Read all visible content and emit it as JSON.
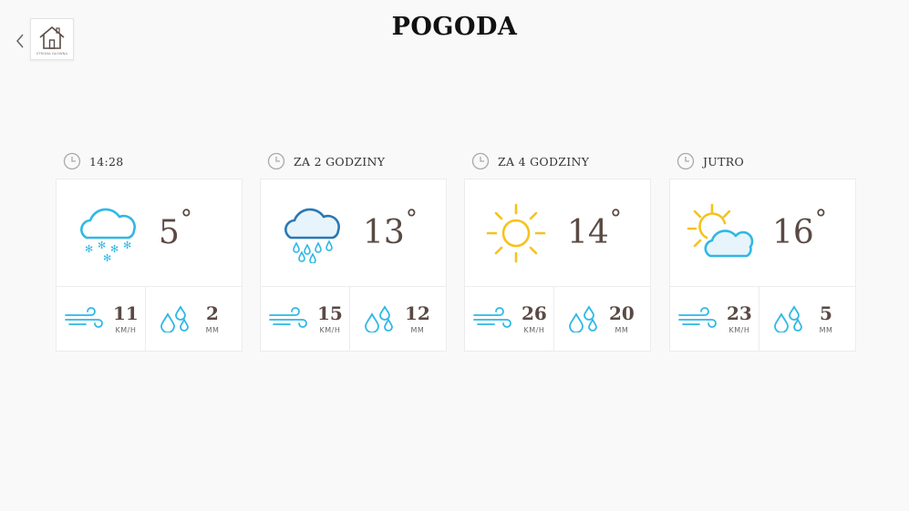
{
  "header": {
    "title": "POGODA",
    "home_label": "STRONA GŁÓWNA",
    "home_icon": "house-icon",
    "back_icon": "chevron-left-icon"
  },
  "forecasts": [
    {
      "time_label": "14:28",
      "condition_icon": "cloud-snow-icon",
      "temperature": "5",
      "wind_value": "11",
      "wind_unit": "KM/H",
      "precip_value": "2",
      "precip_unit": "MM"
    },
    {
      "time_label": "ZA 2 GODZINY",
      "condition_icon": "cloud-rain-icon",
      "temperature": "13",
      "wind_value": "15",
      "wind_unit": "KM/H",
      "precip_value": "12",
      "precip_unit": "MM"
    },
    {
      "time_label": "ZA 4 GODZINY",
      "condition_icon": "sun-icon",
      "temperature": "14",
      "wind_value": "26",
      "wind_unit": "KM/H",
      "precip_value": "20",
      "precip_unit": "MM"
    },
    {
      "time_label": "JUTRO",
      "condition_icon": "partly-cloudy-icon",
      "temperature": "16",
      "wind_value": "23",
      "wind_unit": "KM/H",
      "precip_value": "5",
      "precip_unit": "MM"
    }
  ],
  "degree_symbol": "°",
  "colors": {
    "sky_blue": "#2fb8e6",
    "dark_blue": "#2a78b5",
    "sun_yellow": "#f6c21c",
    "value_brown": "#5a4a44"
  }
}
